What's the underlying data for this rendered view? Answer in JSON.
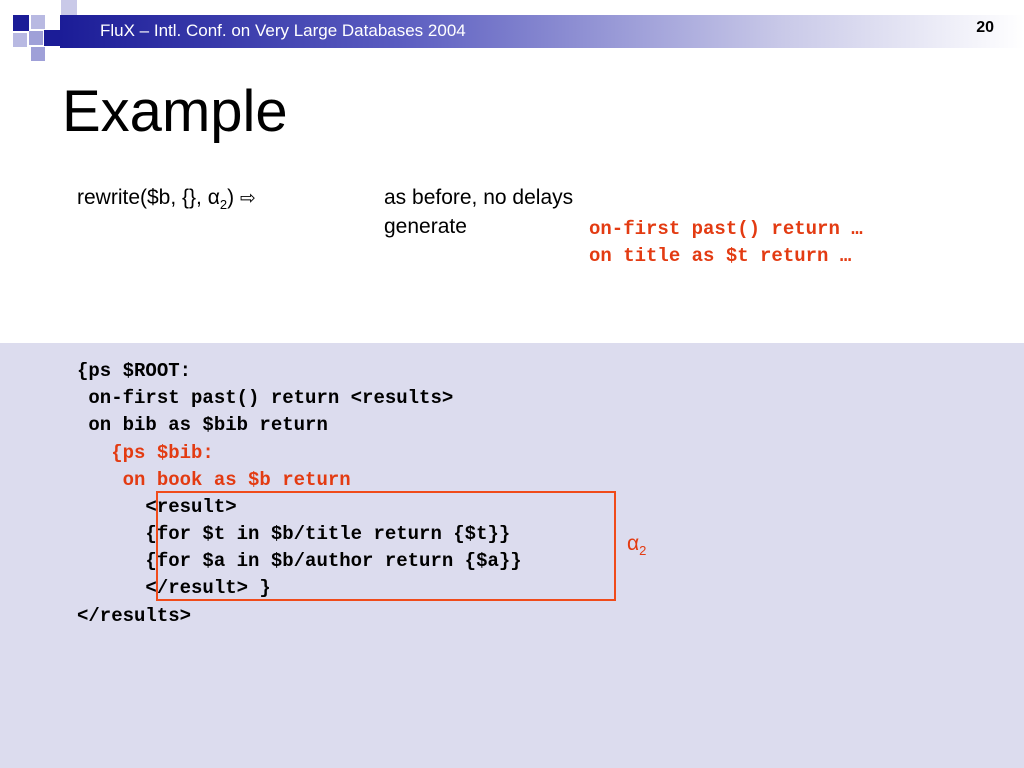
{
  "header": {
    "title": "FluX – Intl. Conf. on Very Large Databases 2004",
    "slide_number": "20",
    "colors": {
      "bar_dark": "#1b1c97",
      "deco_square": "#1b1c97",
      "deco_light": "#9fa0d8"
    }
  },
  "title": "Example",
  "rewrite": {
    "text": "rewrite($b, {}, α",
    "sub": "2",
    "close": ")",
    "arrow": "⇨",
    "line1": "as before, no delays",
    "line2": "generate",
    "code1": "on-first past() return …",
    "code2": "on title as $t return …"
  },
  "code_lines": [
    "{ps $ROOT:",
    " on-first past() return <results>",
    " on bib as $bib return",
    "   {ps $bib:",
    "    on book as $b return",
    "      <result>",
    "      {for $t in $b/title return {$t}}",
    "      {for $a in $b/author return {$a}}",
    "      </result> }",
    "</results>"
  ],
  "alpha_label": {
    "text": "α",
    "sub": "2"
  },
  "colors": {
    "accent_red": "#e33b12",
    "panel_bg": "#dcdcee",
    "box_border": "#f04b1a"
  }
}
